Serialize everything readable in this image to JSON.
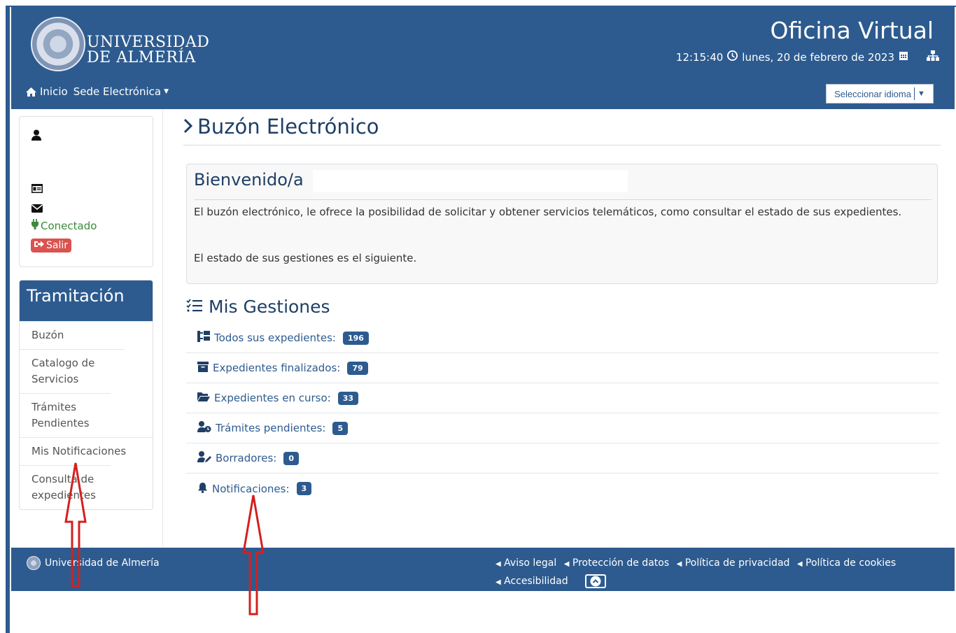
{
  "header": {
    "logo_line1": "UNIVERSIDAD",
    "logo_line2": "DE ALMERÍA",
    "app_title": "Oficina Virtual",
    "time": "12:15:40",
    "date": "lunes, 20 de febrero de 2023",
    "nav": {
      "home": "Inicio",
      "sede": "Sede Electrónica"
    },
    "language_select": "Seleccionar idioma"
  },
  "user_card": {
    "status": "Conectado",
    "logout": "Salir"
  },
  "sidebar": {
    "title": "Tramitación",
    "items": [
      {
        "label": "Buzón"
      },
      {
        "label": "Catalogo de Servicios"
      },
      {
        "label": "Trámites Pendientes"
      },
      {
        "label": "Mis Notificaciones"
      },
      {
        "label": "Consulta de expedientes"
      }
    ]
  },
  "main": {
    "title": "Buzón Electrónico",
    "welcome": {
      "heading": "Bienvenido/a",
      "text1": "El buzón electrónico, le ofrece la posibilidad de solicitar y obtener servicios telemáticos, como consultar el estado de sus expedientes.",
      "text2": "El estado de sus gestiones es el siguiente."
    },
    "gestiones": {
      "title": "Mis Gestiones",
      "items": [
        {
          "label": "Todos sus expedientes:",
          "count": "196",
          "icon": "sitemap-icon"
        },
        {
          "label": "Expedientes finalizados:",
          "count": "79",
          "icon": "archive-icon"
        },
        {
          "label": "Expedientes en curso:",
          "count": "33",
          "icon": "folder-open-icon"
        },
        {
          "label": "Trámites pendientes:",
          "count": "5",
          "icon": "user-clock-icon"
        },
        {
          "label": "Borradores:",
          "count": "0",
          "icon": "user-edit-icon"
        },
        {
          "label": "Notificaciones:",
          "count": "3",
          "icon": "bell-icon"
        }
      ]
    }
  },
  "footer": {
    "brand": "Universidad de Almería",
    "links": [
      "Aviso legal",
      "Protección de datos",
      "Política de privacidad",
      "Política de cookies",
      "Accesibilidad"
    ]
  },
  "colors": {
    "primary": "#2d5b8f",
    "success": "#3c8a3c",
    "danger": "#d9534f",
    "annotation_arrow": "#d32020"
  }
}
